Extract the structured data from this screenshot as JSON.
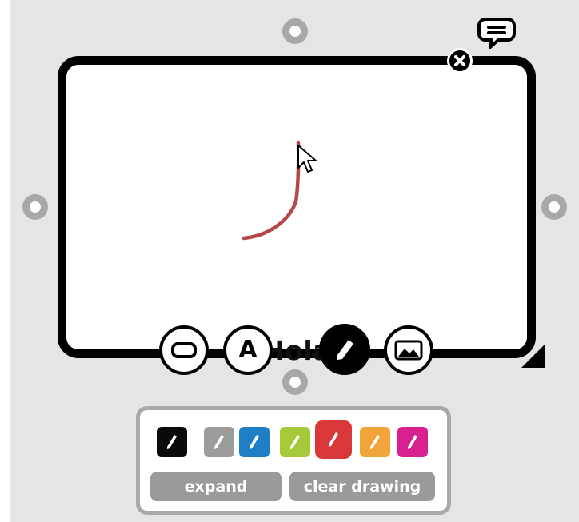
{
  "card": {
    "text": "Hola"
  },
  "tools": [
    {
      "name": "shape",
      "icon": "rounded-rect-icon",
      "active": false
    },
    {
      "name": "text",
      "icon": "letter-a-icon",
      "glyph": "A",
      "active": false
    },
    {
      "name": "draw",
      "icon": "pencil-icon",
      "active": true
    },
    {
      "name": "image",
      "icon": "image-icon",
      "active": false
    }
  ],
  "palette": {
    "colors": [
      {
        "name": "black",
        "hex": "#0a0a0a",
        "selected": false
      },
      {
        "name": "gray",
        "hex": "#9c9c9c",
        "selected": false
      },
      {
        "name": "blue",
        "hex": "#1f7fc4",
        "selected": false
      },
      {
        "name": "lime",
        "hex": "#a6c93a",
        "selected": false
      },
      {
        "name": "red",
        "hex": "#d9373a",
        "selected": true
      },
      {
        "name": "orange",
        "hex": "#f0a43a",
        "selected": false
      },
      {
        "name": "magenta",
        "hex": "#d8208f",
        "selected": false
      }
    ],
    "expand_label": "expand",
    "clear_label": "clear drawing"
  },
  "stroke_color": "#b5474a",
  "icons": {
    "comment": "speech-bubble-icon",
    "close": "close-icon",
    "resize": "resize-corner-icon",
    "cursor": "mouse-pointer-icon"
  }
}
